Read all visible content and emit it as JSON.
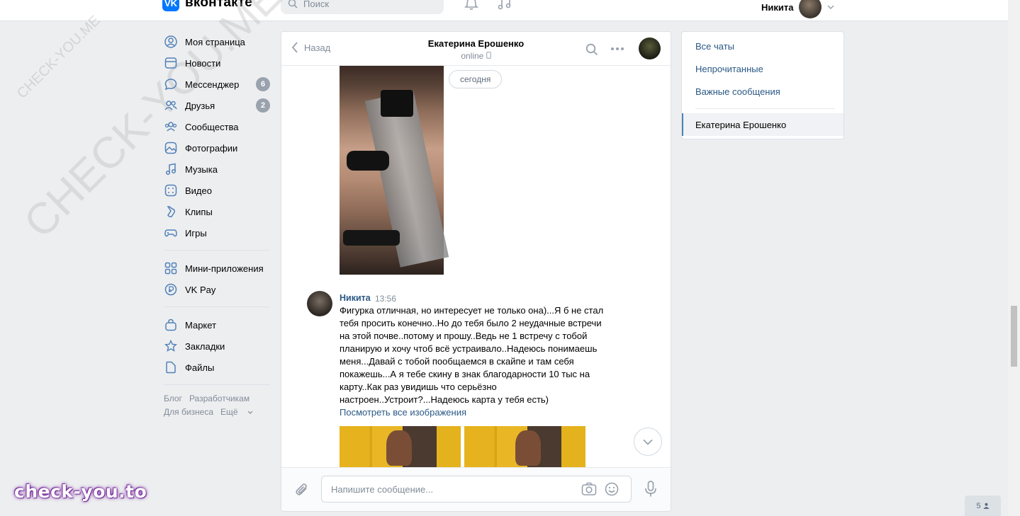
{
  "header": {
    "logo_text": "вконтакте",
    "logo_mark": "VK",
    "search_placeholder": "Поиск",
    "user_name": "Никита",
    "icons": [
      "bell-icon",
      "music-icon",
      "chevron-down-icon"
    ]
  },
  "nav": {
    "items": [
      {
        "label": "Моя страница",
        "icon": "user-circle-icon"
      },
      {
        "label": "Новости",
        "icon": "news-icon"
      },
      {
        "label": "Мессенджер",
        "icon": "message-icon",
        "badge": "6"
      },
      {
        "label": "Друзья",
        "icon": "friends-icon",
        "badge": "2"
      },
      {
        "label": "Сообщества",
        "icon": "communities-icon"
      },
      {
        "label": "Фотографии",
        "icon": "photo-icon"
      },
      {
        "label": "Музыка",
        "icon": "music-icon"
      },
      {
        "label": "Видео",
        "icon": "video-icon"
      },
      {
        "label": "Клипы",
        "icon": "clips-icon"
      },
      {
        "label": "Игры",
        "icon": "gamepad-icon"
      }
    ],
    "items2": [
      {
        "label": "Мини-приложения",
        "icon": "apps-icon"
      },
      {
        "label": "VK Pay",
        "icon": "vkpay-icon"
      }
    ],
    "items3": [
      {
        "label": "Маркет",
        "icon": "market-icon"
      },
      {
        "label": "Закладки",
        "icon": "star-icon"
      },
      {
        "label": "Файлы",
        "icon": "file-icon"
      }
    ],
    "footer": {
      "blog": "Блог",
      "dev": "Разработчикам",
      "business": "Для бизнеса",
      "more": "Ещё"
    }
  },
  "chat": {
    "back_label": "Назад",
    "title": "Екатерина Ерошенко",
    "status": "online",
    "date_label": "сегодня",
    "message": {
      "author": "Никита",
      "time": "13:56",
      "text": "Фигурка отличная, но интересует не только она)...Я б не стал тебя просить конечно..Но до тебя было 2 неудачные встречи на этой почве..потому и прошу..Ведь не 1 встречу с тобой планирую и хочу чтоб всё устраивало..Надеюсь понимаешь меня...Давай с тобой пообщаемся в скайпе и там себя покажешь...А я тебе скину в знак благодарности 10 тыс на карту..Как раз увидишь что серьёзно настроен..Устроит?...Надеюсь карта у тебя есть)",
      "link": "Посмотреть все изображения"
    },
    "compose_placeholder": "Напишите сообщение..."
  },
  "right_panel": {
    "all_chats": "Все чаты",
    "unread": "Непрочитанные",
    "important": "Важные сообщения",
    "active_chat": "Екатерина Ерошенко"
  },
  "watermark": {
    "big": "CHECK-YOU.ME",
    "small": "CHECK-YOU.ME",
    "brand": "check-you.to"
  },
  "online_count": "5",
  "colors": {
    "accent": "#2a5885",
    "brand": "#0077ff",
    "background": "#edeef0"
  }
}
